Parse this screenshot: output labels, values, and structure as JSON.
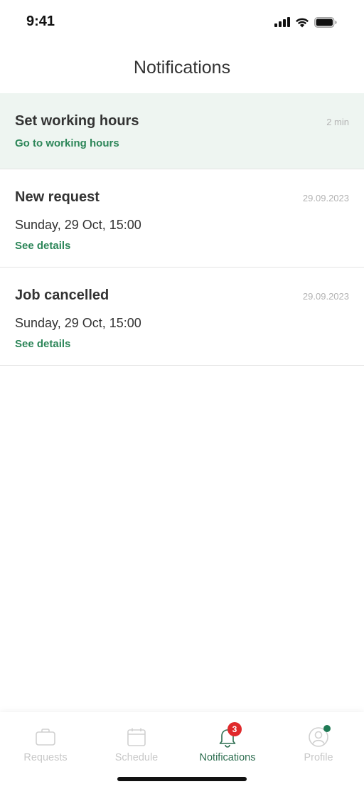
{
  "status_bar": {
    "time": "9:41"
  },
  "header": {
    "title": "Notifications"
  },
  "notifications": [
    {
      "title": "Set working hours",
      "time": "2 min",
      "link": "Go to working hours"
    },
    {
      "title": "New request",
      "time": "29.09.2023",
      "subtitle": "Sunday, 29 Oct, 15:00",
      "link": "See details"
    },
    {
      "title": "Job cancelled",
      "time": "29.09.2023",
      "subtitle": "Sunday, 29 Oct, 15:00",
      "link": "See details"
    }
  ],
  "tab_bar": {
    "items": [
      {
        "label": "Requests",
        "icon": "briefcase-icon"
      },
      {
        "label": "Schedule",
        "icon": "calendar-icon"
      },
      {
        "label": "Notifications",
        "icon": "bell-icon",
        "badge": "3",
        "active": true
      },
      {
        "label": "Profile",
        "icon": "user-icon"
      }
    ]
  },
  "colors": {
    "accent": "#2d8659",
    "active_tab": "#2d6e50",
    "highlight_bg": "#eef5f1",
    "badge": "#e0292b",
    "inactive_tab": "#c8c8c8"
  }
}
